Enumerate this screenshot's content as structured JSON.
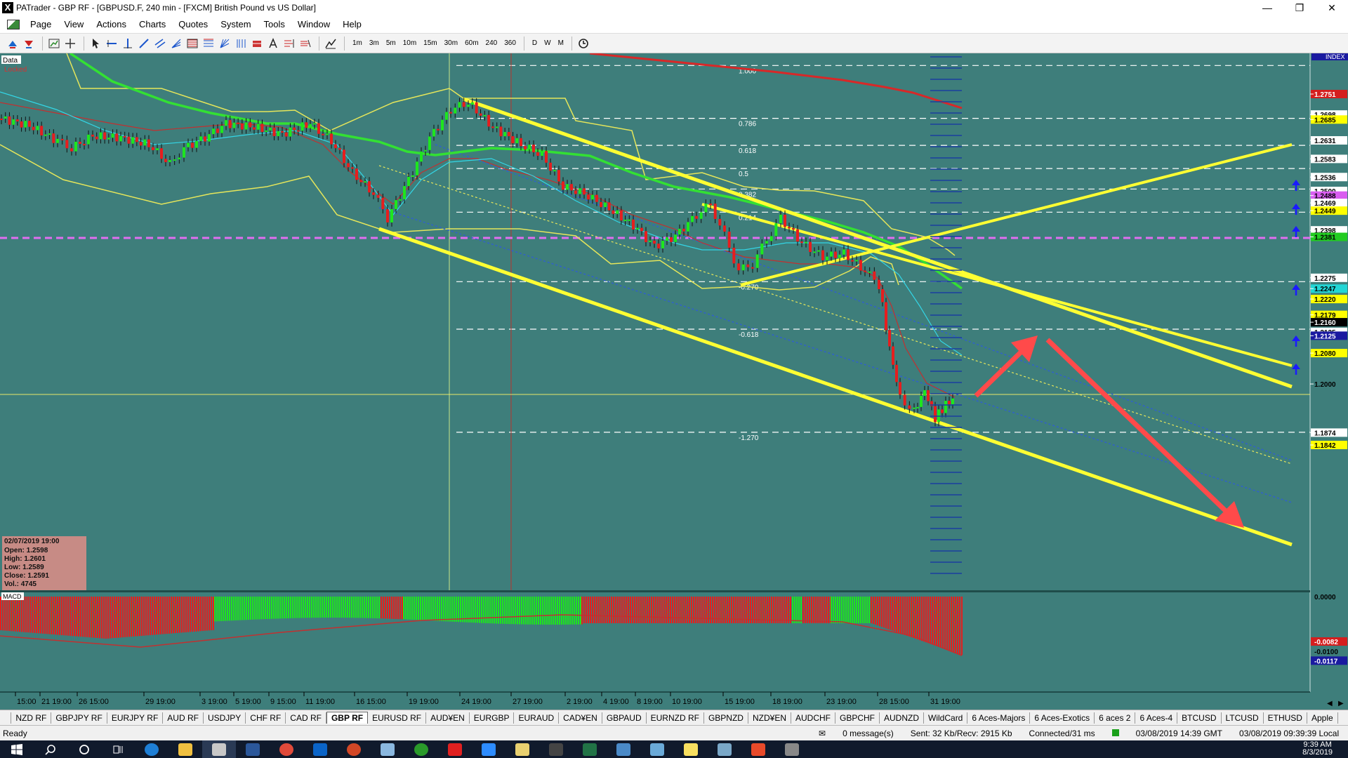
{
  "window": {
    "title": "PATrader - GBP RF - [GBPUSD.F, 240 min - [FXCM] British Pound vs US Dollar]",
    "app_icon": "X"
  },
  "menu": [
    "Page",
    "View",
    "Actions",
    "Charts",
    "Quotes",
    "System",
    "Tools",
    "Window",
    "Help"
  ],
  "timeframes": [
    "1m",
    "3m",
    "5m",
    "10m",
    "15m",
    "30m",
    "60m",
    "240",
    "360",
    "D",
    "W",
    "M"
  ],
  "chart": {
    "data_label": "Data",
    "locked_label": "Locked",
    "index_label": "INDEX",
    "macd_label": "MACD",
    "fib_levels": [
      {
        "label": "1.000",
        "price": 1.2825
      },
      {
        "label": "0.786",
        "price": 1.2688
      },
      {
        "label": "0.618",
        "price": 1.2618
      },
      {
        "label": "0.5",
        "price": 1.2558
      },
      {
        "label": "0.382",
        "price": 1.2505
      },
      {
        "label": "0.214",
        "price": 1.2445
      },
      {
        "label": "-0.270",
        "price": 1.2265
      },
      {
        "label": "-0.618",
        "price": 1.2142
      },
      {
        "label": "-1.270",
        "price": 1.1875
      }
    ],
    "price_axis": [
      {
        "label": "1.2751",
        "price": 1.2751,
        "bg": "#d41e1e",
        "color": "#ffffff"
      },
      {
        "label": "1.2698",
        "price": 1.2698,
        "bg": "#ffffff",
        "color": "#000000"
      },
      {
        "label": "1.2685",
        "price": 1.2685,
        "bg": "#ffff00",
        "color": "#000000"
      },
      {
        "label": "1.2631",
        "price": 1.2631,
        "bg": "#ffffff",
        "color": "#000000"
      },
      {
        "label": "1.2583",
        "price": 1.2583,
        "bg": "#ffffff",
        "color": "#000000"
      },
      {
        "label": "1.2536",
        "price": 1.2536,
        "bg": "#ffffff",
        "color": "#000000"
      },
      {
        "label": "1.2500",
        "price": 1.25,
        "bg": "#ffffff",
        "color": "#000000"
      },
      {
        "label": "1.2488",
        "price": 1.2488,
        "bg": "#d95ef0",
        "color": "#000000"
      },
      {
        "label": "1.2469",
        "price": 1.2469,
        "bg": "#ffffff",
        "color": "#000000"
      },
      {
        "label": "1.2449",
        "price": 1.2449,
        "bg": "#ffff00",
        "color": "#000000"
      },
      {
        "label": "1.2398",
        "price": 1.2398,
        "bg": "#ffffff",
        "color": "#000000"
      },
      {
        "label": "1.2381",
        "price": 1.2381,
        "bg": "#22cc22",
        "color": "#000000"
      },
      {
        "label": "1.2275",
        "price": 1.2275,
        "bg": "#ffffff",
        "color": "#000000"
      },
      {
        "label": "1.2247",
        "price": 1.2247,
        "bg": "#22d6d6",
        "color": "#000000"
      },
      {
        "label": "1.2220",
        "price": 1.222,
        "bg": "#ffff00",
        "color": "#000000"
      },
      {
        "label": "1.2179",
        "price": 1.2179,
        "bg": "#ffff00",
        "color": "#000000"
      },
      {
        "label": "1.2160",
        "price": 1.216,
        "bg": "#000000",
        "color": "#ffffff"
      },
      {
        "label": "1.2135",
        "price": 1.2135,
        "bg": "#ffffff",
        "color": "#000000"
      },
      {
        "label": "1.2125",
        "price": 1.2125,
        "bg": "#1a1aa0",
        "color": "#ffffff"
      },
      {
        "label": "1.2080",
        "price": 1.208,
        "bg": "#ffff00",
        "color": "#000000"
      },
      {
        "label": "1.2000",
        "price": 1.2,
        "bg": "",
        "color": "#000000"
      },
      {
        "label": "1.1874",
        "price": 1.1874,
        "bg": "#ffffff",
        "color": "#000000"
      },
      {
        "label": "1.1842",
        "price": 1.1842,
        "bg": "#ffff00",
        "color": "#000000"
      }
    ],
    "macd_axis": [
      {
        "label": "0.0000",
        "value": 0.0,
        "bg": "",
        "color": "#000000"
      },
      {
        "label": "-0.0082",
        "value": -0.0082,
        "bg": "#d41e1e",
        "color": "#ffffff"
      },
      {
        "label": "-0.0100",
        "value": -0.01,
        "bg": "",
        "color": "#000000"
      },
      {
        "label": "-0.0117",
        "value": -0.0117,
        "bg": "#1a1aa0",
        "color": "#ffffff"
      }
    ],
    "time_axis": [
      "15:00",
      "21 19:00",
      "26 15:00",
      "29 19:00",
      "3 19:00",
      "5 19:00",
      "9 15:00",
      "11 19:00",
      "16 15:00",
      "19 19:00",
      "24 19:00",
      "27 19:00",
      "2 19:00",
      "4 19:00",
      "8 19:00",
      "10 19:00",
      "15 19:00",
      "18 19:00",
      "23 19:00",
      "28 15:00",
      "31 19:00"
    ],
    "info_box": {
      "date": "02/07/2019 19:00",
      "open": "Open: 1.2598",
      "high": "High: 1.2601",
      "low": "Low: 1.2589",
      "close": "Close: 1.2591",
      "vol": "Vol.: 4745"
    },
    "colors": {
      "background": "#3e7e7b",
      "bull_candle": "#1ee61e",
      "bear_candle": "#e61e1e",
      "channel": "#ffff33",
      "arrow": "#ff4444",
      "ma_green": "#33e033",
      "ma_red": "#e02a2a",
      "ma_cyan": "#33d6e6",
      "pivot": "#e06ef0"
    }
  },
  "tabs": [
    "NZD RF",
    "GBPJPY RF",
    "EURJPY RF",
    "AUD RF",
    "USDJPY",
    "CHF RF",
    "CAD RF",
    "GBP RF",
    "EURUSD RF",
    "AUD¥EN",
    "EURGBP",
    "EURAUD",
    "CAD¥EN",
    "GBPAUD",
    "EURNZD RF",
    "GBPNZD",
    "NZD¥EN",
    "AUDCHF",
    "GBPCHF",
    "AUDNZD",
    "WildCard",
    "6 Aces-Majors",
    "6 Aces-Exotics",
    "6 aces 2",
    "6 Aces-4",
    "BTCUSD",
    "LTCUSD",
    "ETHUSD",
    "Apple"
  ],
  "active_tab": "GBP RF",
  "status": {
    "ready": "Ready",
    "messages": "0 message(s)",
    "traffic": "Sent: 32 Kb/Recv: 2915 Kb",
    "connection": "Connected/31 ms",
    "server_time": "03/08/2019 14:39 GMT",
    "local_time": "03/08/2019 09:39:39 Local"
  },
  "clock": {
    "time": "9:39 AM",
    "date": "8/3/2019"
  }
}
